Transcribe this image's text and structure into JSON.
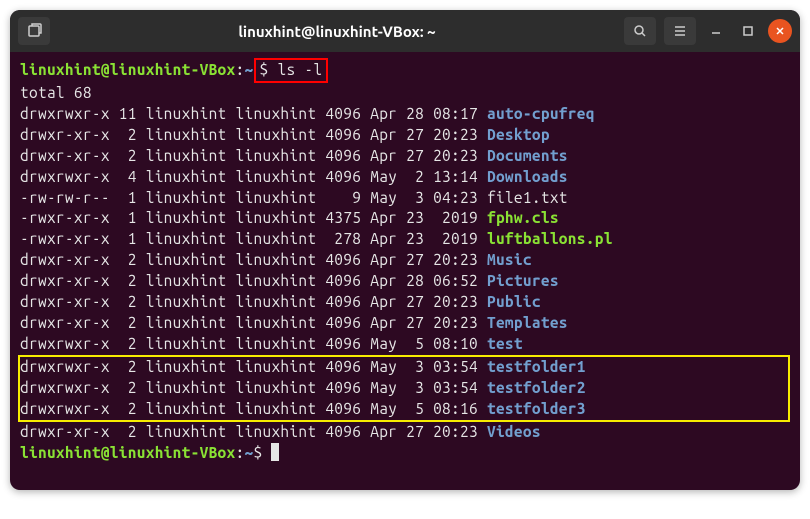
{
  "titlebar": {
    "title": "linuxhint@linuxhint-VBox: ~"
  },
  "prompt": {
    "userhost": "linuxhint@linuxhint-VBox",
    "colon": ":",
    "path": "~",
    "dollar": "$"
  },
  "command": "ls -l",
  "total_line": "total 68",
  "rows": [
    {
      "perm": "drwxrwxr-x",
      "links": "11",
      "owner": "linuxhint",
      "group": "linuxhint",
      "size": "4096",
      "date": "Apr 28 08:17",
      "name": "auto-cpufreq",
      "type": "dir"
    },
    {
      "perm": "drwxr-xr-x",
      "links": " 2",
      "owner": "linuxhint",
      "group": "linuxhint",
      "size": "4096",
      "date": "Apr 27 20:23",
      "name": "Desktop",
      "type": "dir"
    },
    {
      "perm": "drwxr-xr-x",
      "links": " 2",
      "owner": "linuxhint",
      "group": "linuxhint",
      "size": "4096",
      "date": "Apr 27 20:23",
      "name": "Documents",
      "type": "dir"
    },
    {
      "perm": "drwxrwxr-x",
      "links": " 4",
      "owner": "linuxhint",
      "group": "linuxhint",
      "size": "4096",
      "date": "May  2 13:14",
      "name": "Downloads",
      "type": "dir"
    },
    {
      "perm": "-rw-rw-r--",
      "links": " 1",
      "owner": "linuxhint",
      "group": "linuxhint",
      "size": "   9",
      "date": "May  3 04:23",
      "name": "file1.txt",
      "type": "file"
    },
    {
      "perm": "-rwxr-xr-x",
      "links": " 1",
      "owner": "linuxhint",
      "group": "linuxhint",
      "size": "4375",
      "date": "Apr 23  2019",
      "name": "fphw.cls",
      "type": "exec"
    },
    {
      "perm": "-rwxr-xr-x",
      "links": " 1",
      "owner": "linuxhint",
      "group": "linuxhint",
      "size": " 278",
      "date": "Apr 23  2019",
      "name": "luftballons.pl",
      "type": "exec"
    },
    {
      "perm": "drwxr-xr-x",
      "links": " 2",
      "owner": "linuxhint",
      "group": "linuxhint",
      "size": "4096",
      "date": "Apr 27 20:23",
      "name": "Music",
      "type": "dir"
    },
    {
      "perm": "drwxr-xr-x",
      "links": " 2",
      "owner": "linuxhint",
      "group": "linuxhint",
      "size": "4096",
      "date": "Apr 28 06:52",
      "name": "Pictures",
      "type": "dir"
    },
    {
      "perm": "drwxr-xr-x",
      "links": " 2",
      "owner": "linuxhint",
      "group": "linuxhint",
      "size": "4096",
      "date": "Apr 27 20:23",
      "name": "Public",
      "type": "dir"
    },
    {
      "perm": "drwxr-xr-x",
      "links": " 2",
      "owner": "linuxhint",
      "group": "linuxhint",
      "size": "4096",
      "date": "Apr 27 20:23",
      "name": "Templates",
      "type": "dir"
    },
    {
      "perm": "drwxrwxr-x",
      "links": " 2",
      "owner": "linuxhint",
      "group": "linuxhint",
      "size": "4096",
      "date": "May  5 08:10",
      "name": "test",
      "type": "dir"
    },
    {
      "perm": "drwxrwxr-x",
      "links": " 2",
      "owner": "linuxhint",
      "group": "linuxhint",
      "size": "4096",
      "date": "May  3 03:54",
      "name": "testfolder1",
      "type": "dir",
      "hl": true
    },
    {
      "perm": "drwxrwxr-x",
      "links": " 2",
      "owner": "linuxhint",
      "group": "linuxhint",
      "size": "4096",
      "date": "May  3 03:54",
      "name": "testfolder2",
      "type": "dir",
      "hl": true
    },
    {
      "perm": "drwxrwxr-x",
      "links": " 2",
      "owner": "linuxhint",
      "group": "linuxhint",
      "size": "4096",
      "date": "May  5 08:16",
      "name": "testfolder3",
      "type": "dir",
      "hl": true
    },
    {
      "perm": "drwxr-xr-x",
      "links": " 2",
      "owner": "linuxhint",
      "group": "linuxhint",
      "size": "4096",
      "date": "Apr 27 20:23",
      "name": "Videos",
      "type": "dir"
    }
  ],
  "colors": {
    "bg": "#2d0922",
    "dir": "#729fcf",
    "exec": "#8ae234",
    "prompt": "#8ae234",
    "hl_red": "#ff0000",
    "hl_yellow": "#f7ec00"
  }
}
